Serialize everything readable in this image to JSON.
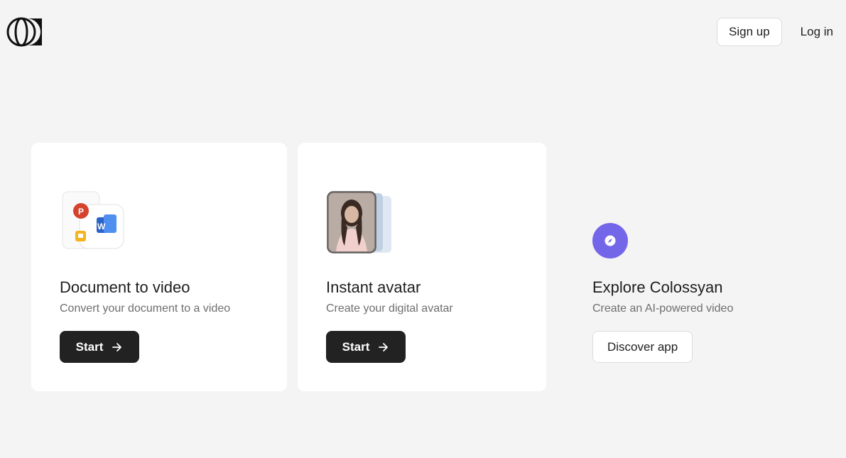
{
  "header": {
    "signup_label": "Sign up",
    "login_label": "Log in"
  },
  "cards": [
    {
      "title": "Document to video",
      "subtitle": "Convert your document to a video",
      "button_label": "Start",
      "icon": "document-apps-icon"
    },
    {
      "title": "Instant avatar",
      "subtitle": "Create your digital avatar",
      "button_label": "Start",
      "icon": "avatar-photo-icon"
    },
    {
      "title": "Explore Colossyan",
      "subtitle": "Create an AI-powered video",
      "button_label": "Discover app",
      "icon": "compass-icon"
    }
  ],
  "colors": {
    "background": "#f4f4f4",
    "dark_button": "#222222",
    "accent_purple": "#7466e8"
  }
}
